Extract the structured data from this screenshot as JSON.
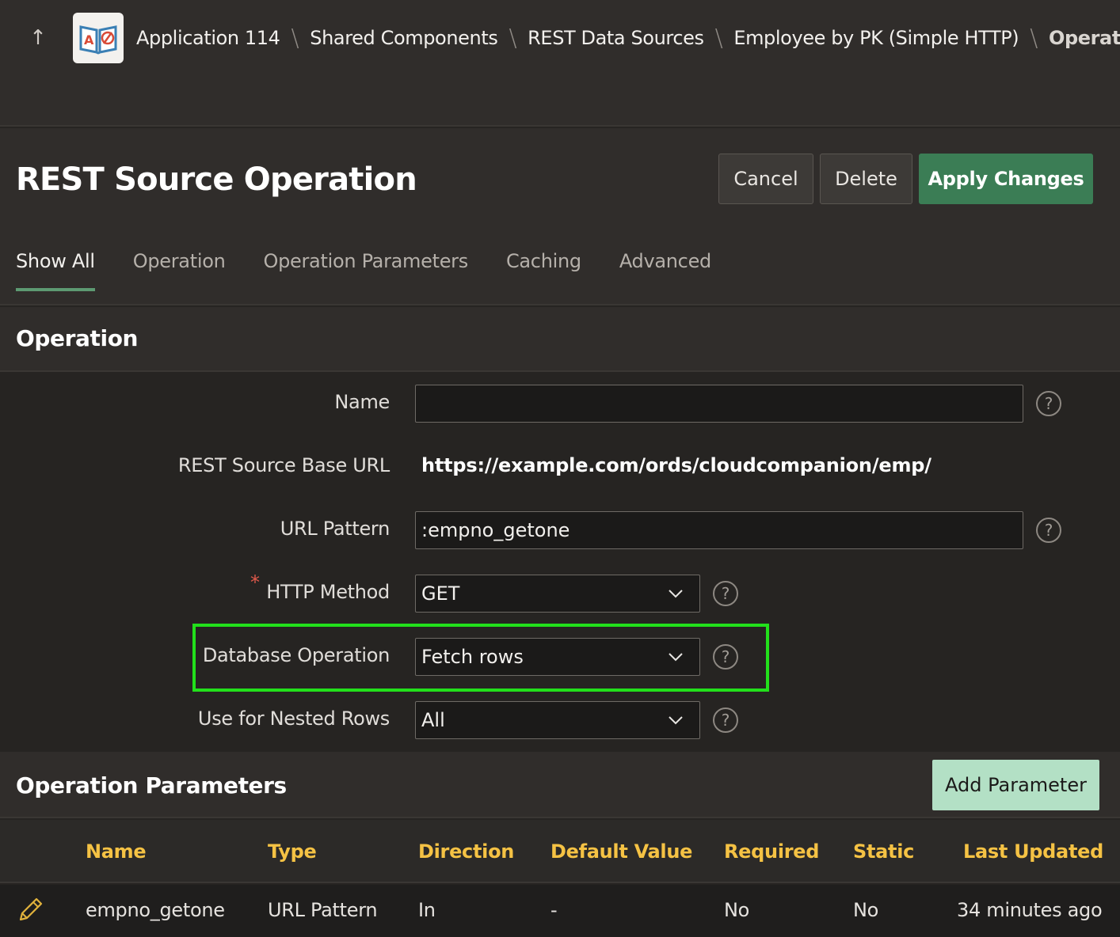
{
  "breadcrumbs": {
    "up_icon": "arrow-up-icon",
    "app_icon": "app-book-icon",
    "items": [
      {
        "label": "Application 114"
      },
      {
        "label": "Shared Components"
      },
      {
        "label": "REST Data Sources"
      },
      {
        "label": "Employee by PK (Simple HTTP)"
      },
      {
        "label": "Operation"
      }
    ],
    "separator": "\\"
  },
  "header": {
    "title": "REST Source Operation",
    "cancel_label": "Cancel",
    "delete_label": "Delete",
    "apply_label": "Apply Changes"
  },
  "tabs": [
    {
      "label": "Show All",
      "active": true
    },
    {
      "label": "Operation"
    },
    {
      "label": "Operation Parameters"
    },
    {
      "label": "Caching"
    },
    {
      "label": "Advanced"
    }
  ],
  "operation_region": {
    "title": "Operation",
    "name_label": "Name",
    "name_value": "",
    "base_url_label": "REST Source Base URL",
    "base_url_value": "https://example.com/ords/cloudcompanion/emp/",
    "url_pattern_label": "URL Pattern",
    "url_pattern_value": ":empno_getone",
    "http_method_label": "HTTP Method",
    "http_method_value": "GET",
    "required_marker": "*",
    "db_operation_label": "Database Operation",
    "db_operation_value": "Fetch rows",
    "nested_rows_label": "Use for Nested Rows",
    "nested_rows_value": "All",
    "help_glyph": "?",
    "highlight_color": "#22e01b"
  },
  "parameters_region": {
    "title": "Operation Parameters",
    "add_label": "Add Parameter",
    "columns": [
      "Name",
      "Type",
      "Direction",
      "Default Value",
      "Required",
      "Static",
      "Last Updated"
    ],
    "rows": [
      {
        "name": "empno_getone",
        "type": "URL Pattern",
        "direction": "In",
        "default_value": "-",
        "required": "No",
        "static": "No",
        "last_updated": "34 minutes ago"
      }
    ]
  },
  "colors": {
    "primary_button": "#3b7d55",
    "add_button": "#b3e0c5",
    "header_text": "#f5c244",
    "tab_underline": "#5d9a72"
  }
}
